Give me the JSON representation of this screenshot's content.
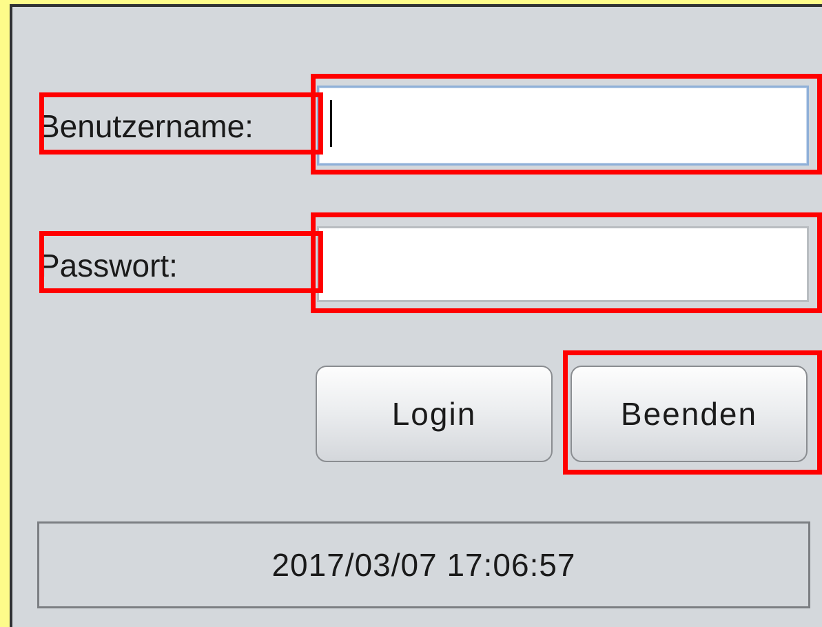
{
  "form": {
    "username_label": "Benutzername:",
    "username_value": "",
    "password_label": "Passwort:",
    "password_value": ""
  },
  "buttons": {
    "login_label": "Login",
    "exit_label": "Beenden"
  },
  "status_bar": {
    "timestamp": "2017/03/07 17:06:57"
  },
  "colors": {
    "highlight": "#ff0000",
    "background": "#fdfb8a",
    "panel": "#d4d8dc"
  }
}
